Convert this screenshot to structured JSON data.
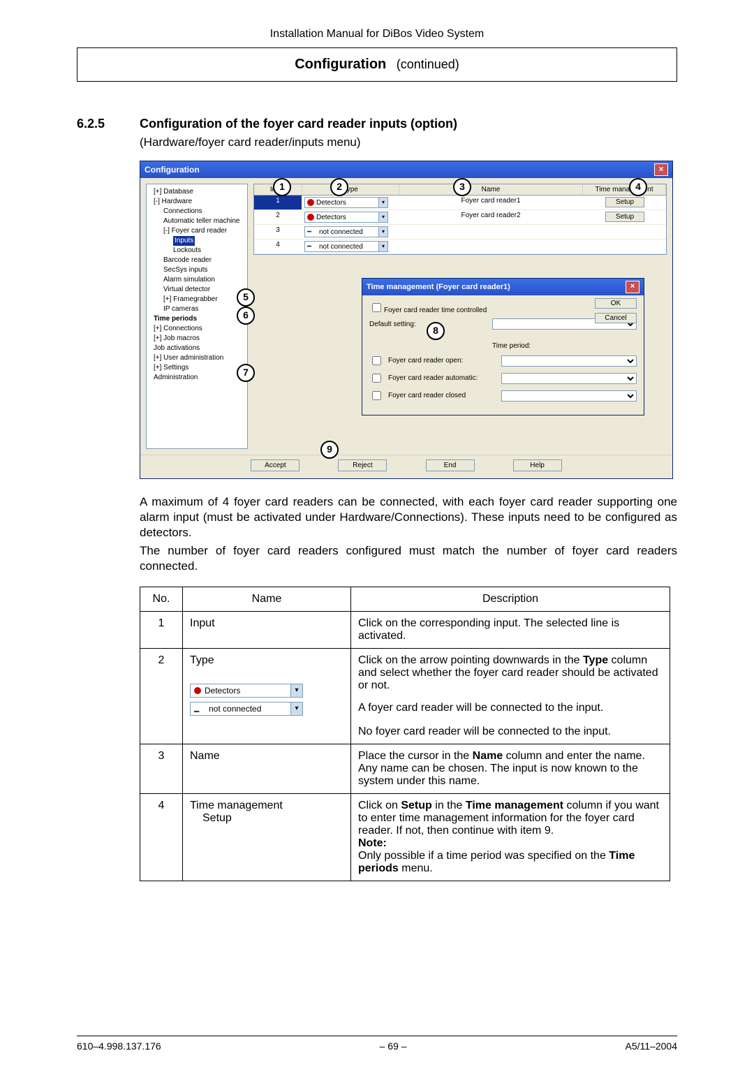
{
  "doc_header": "Installation Manual for DiBos Video System",
  "config_label_bold": "Configuration",
  "config_label_cont": "(continued)",
  "section_number": "6.2.5",
  "section_title": "Configuration of the foyer card reader inputs (option)",
  "subtitle": "(Hardware/foyer card reader/inputs menu)",
  "window": {
    "title": "Configuration",
    "cols": {
      "input": "Input",
      "type": "Type",
      "name": "Name",
      "tm": "Time management"
    },
    "tree": [
      {
        "lvl": 1,
        "txt": "Database",
        "exp": "+"
      },
      {
        "lvl": 1,
        "txt": "Hardware",
        "exp": "-"
      },
      {
        "lvl": 2,
        "txt": "Connections"
      },
      {
        "lvl": 2,
        "txt": "Automatic teller machine"
      },
      {
        "lvl": 2,
        "txt": "Foyer card reader",
        "exp": "-"
      },
      {
        "lvl": 3,
        "txt": "Inputs",
        "sel": true
      },
      {
        "lvl": 3,
        "txt": "Lockouts"
      },
      {
        "lvl": 2,
        "txt": "Barcode reader"
      },
      {
        "lvl": 2,
        "txt": "SecSys inputs"
      },
      {
        "lvl": 2,
        "txt": "Alarm simulation"
      },
      {
        "lvl": 2,
        "txt": "Virtual detector"
      },
      {
        "lvl": 2,
        "txt": "Framegrabber",
        "exp": "+"
      },
      {
        "lvl": 2,
        "txt": "IP cameras"
      },
      {
        "lvl": 1,
        "txt": "Time periods",
        "bold": true
      },
      {
        "lvl": 1,
        "txt": "Connections",
        "exp": "+"
      },
      {
        "lvl": 1,
        "txt": "Job macros",
        "exp": "+"
      },
      {
        "lvl": 1,
        "txt": "Job activations"
      },
      {
        "lvl": 1,
        "txt": "User administration",
        "exp": "+"
      },
      {
        "lvl": 1,
        "txt": "Settings",
        "exp": "+"
      },
      {
        "lvl": 1,
        "txt": "Administration"
      }
    ],
    "rows": [
      {
        "n": "1",
        "type": "Detectors",
        "name": "Foyer card reader1",
        "tm": "Setup",
        "on": true
      },
      {
        "n": "2",
        "type": "Detectors",
        "name": "Foyer card reader2",
        "tm": "Setup"
      },
      {
        "n": "3",
        "type": "not connected",
        "name": "",
        "nc": true
      },
      {
        "n": "4",
        "type": "not connected",
        "name": "",
        "nc": true
      }
    ],
    "popup": {
      "title": "Time management (Foyer card reader1)",
      "chk_time": "Foyer card reader time controlled",
      "default": "Default setting:",
      "tp": "Time period:",
      "open": "Foyer card reader open:",
      "auto": "Foyer card reader automatic:",
      "closed": "Foyer card reader closed",
      "ok": "OK",
      "cancel": "Cancel"
    },
    "buttons": {
      "accept": "Accept",
      "reject": "Reject",
      "end": "End",
      "help": "Help"
    }
  },
  "body_para1": "A maximum of 4 foyer card readers can be connected, with each foyer card reader supporting one alarm input (must be activated under Hardware/Connections). These inputs need to be configured as detectors.",
  "body_para2": "The number of foyer card readers configured must match the number of foyer card readers connected.",
  "table": {
    "head": {
      "no": "No.",
      "name": "Name",
      "desc": "Description"
    },
    "r1": {
      "no": "1",
      "name": "Input",
      "desc": "Click on the corresponding input. The selected line is activated."
    },
    "r2": {
      "no": "2",
      "name": "Type",
      "d1": "Click on the arrow pointing downwards in the ",
      "d1b": "Type",
      "d1c": " column and select whether the foyer card reader should be activated or not.",
      "d2": "A foyer card reader will be connected to the input.",
      "d3": "No foyer card reader will be connected to the input.",
      "dd1": "Detectors",
      "dd2": "not connected"
    },
    "r3": {
      "no": "3",
      "name": "Name",
      "d1": "Place the cursor in the ",
      "d1b": "Name",
      "d1c": " column and enter the name. Any name can be chosen. The input is now known to the system under this name."
    },
    "r4": {
      "no": "4",
      "name1": "Time management",
      "name2": "Setup",
      "d1": "Click on ",
      "d1b": "Setup",
      "d1c": " in the ",
      "d1d": "Time management",
      "d1e": " column if you want to enter time management information for the foyer card reader.   If not, then continue with item 9.",
      "note": "Note:",
      "d2": "Only possible if a time period was specified on the ",
      "d2b": "Time periods",
      "d2c": " menu."
    }
  },
  "footer": {
    "left": "610–4.998.137.176",
    "center": "– 69  –",
    "right": "A5/11–2004"
  }
}
